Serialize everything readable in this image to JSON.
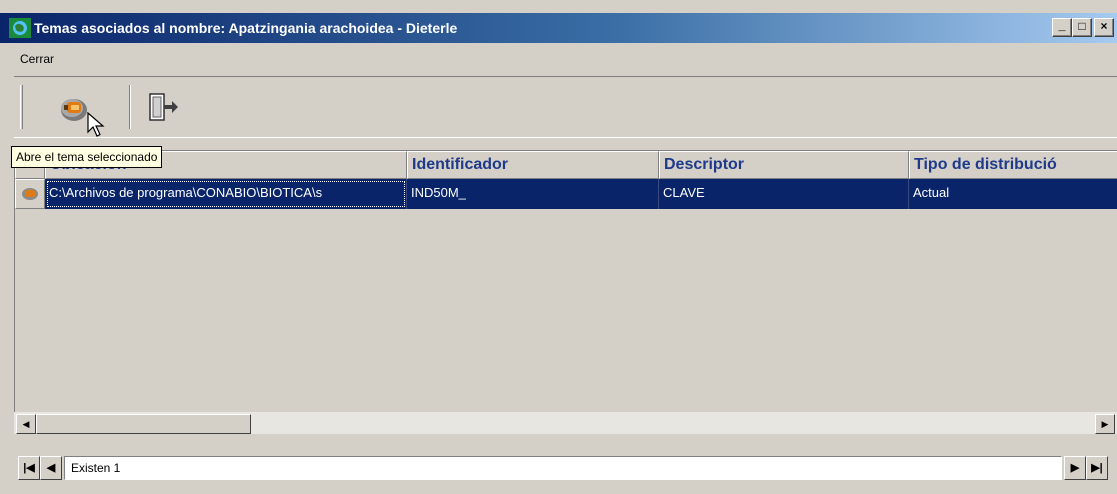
{
  "window": {
    "title": "Temas asociados al nombre: Apatzingania arachoidea - Dieterle",
    "controls": {
      "minimize": "_",
      "maximize": "□",
      "close": "×"
    }
  },
  "menu": {
    "items": [
      "Cerrar"
    ]
  },
  "toolbar": {
    "buttons": [
      {
        "icon": "open-theme-icon"
      },
      {
        "icon": "exit-door-icon"
      }
    ]
  },
  "tooltip": {
    "text": "Abre el tema seleccionado"
  },
  "grid": {
    "columns": [
      "Ubicación",
      "Identificador",
      "Descriptor",
      "Tipo de distribució"
    ],
    "rows": [
      {
        "ubicacion": "C:\\Archivos de programa\\CONABIO\\BIOTICA\\s",
        "identificador": "IND50M_",
        "descriptor": "CLAVE",
        "tipo": "Actual"
      }
    ]
  },
  "navigator": {
    "first": "|◀",
    "prev": "◀",
    "status": "Existen 1",
    "next": "▶",
    "last": "▶|"
  },
  "colors": {
    "selection": "#0a246a",
    "header_text": "#1f3a8a",
    "window_bg": "#d4d0c8",
    "tooltip_bg": "#ffffe1"
  }
}
